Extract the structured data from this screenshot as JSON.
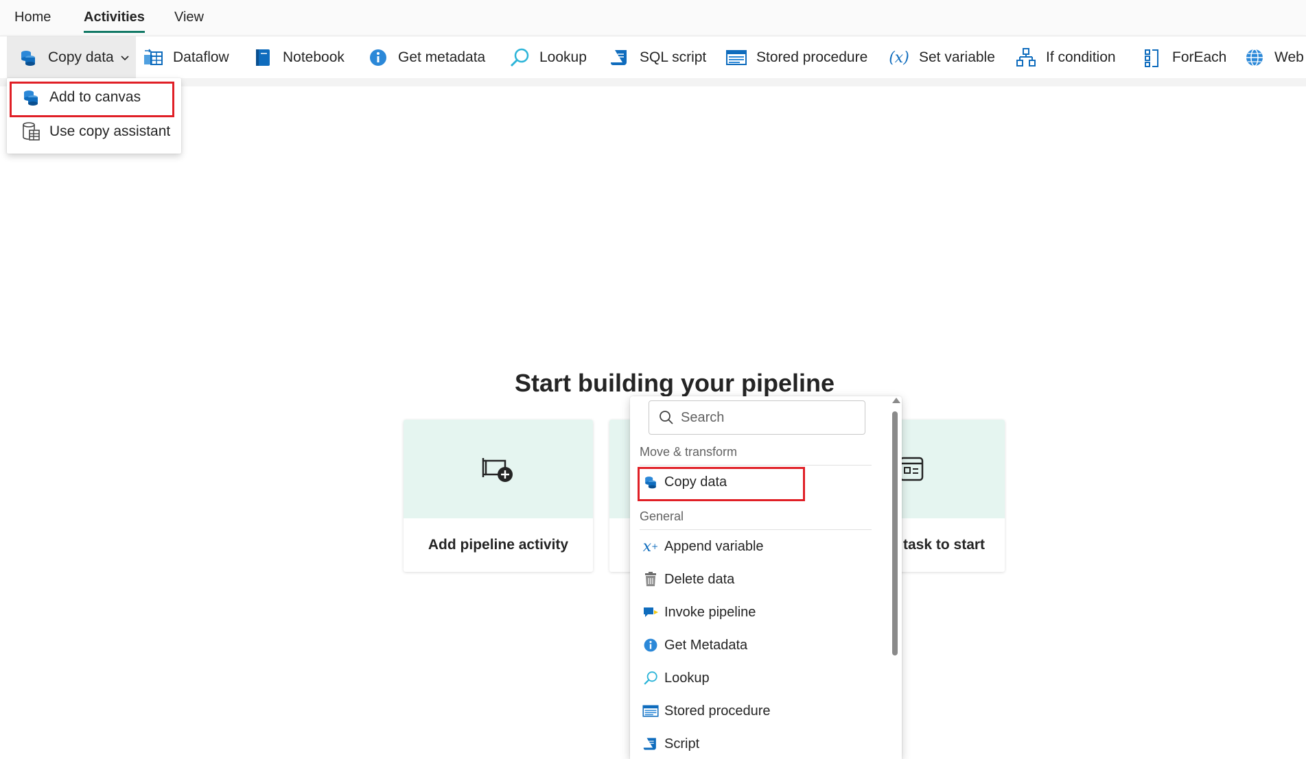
{
  "top_tabs": [
    "Home",
    "Activities",
    "View"
  ],
  "ribbon": {
    "copy_data": "Copy data",
    "dataflow": "Dataflow",
    "notebook": "Notebook",
    "get_metadata": "Get metadata",
    "lookup": "Lookup",
    "sql_script": "SQL script",
    "stored_procedure": "Stored procedure",
    "set_variable": "Set variable",
    "if_condition": "If condition",
    "foreach": "ForEach",
    "web": "Web"
  },
  "copy_dropdown": {
    "items": [
      "Add to canvas",
      "Use copy assistant"
    ]
  },
  "canvas": {
    "title": "Start building your pipeline",
    "cards": [
      "Add pipeline activity",
      "task to start"
    ]
  },
  "activity_panel": {
    "search_placeholder": "Search",
    "section_move": "Move & transform",
    "move_items": [
      "Copy data"
    ],
    "section_general": "General",
    "general_items": [
      "Append variable",
      "Delete data",
      "Invoke pipeline",
      "Get Metadata",
      "Lookup",
      "Stored procedure",
      "Script"
    ]
  },
  "colors": {
    "accent_underline": "#117865",
    "highlight_box": "#e01f26",
    "card_top": "#e5f5f0",
    "icon_blue": "#0f6cbd"
  },
  "icons": [
    "copy-data-icon",
    "dataflow-icon",
    "notebook-icon",
    "info-icon",
    "lookup-icon",
    "script-icon",
    "stored-procedure-icon",
    "variable-icon",
    "if-condition-icon",
    "foreach-icon",
    "globe-icon",
    "chevron-down-icon",
    "search-icon",
    "trash-icon",
    "invoke-pipeline-icon",
    "pipeline-activity-icon",
    "task-icon"
  ]
}
